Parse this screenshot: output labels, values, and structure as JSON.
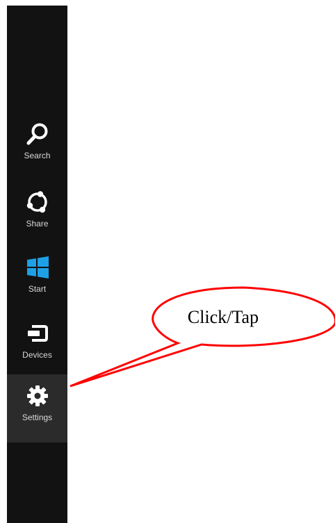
{
  "charms": [
    {
      "id": "search",
      "label": "Search",
      "icon": "search-icon"
    },
    {
      "id": "share",
      "label": "Share",
      "icon": "share-icon"
    },
    {
      "id": "start",
      "label": "Start",
      "icon": "windows-logo-icon"
    },
    {
      "id": "devices",
      "label": "Devices",
      "icon": "devices-icon"
    },
    {
      "id": "settings",
      "label": "Settings",
      "icon": "gear-icon",
      "selected": true
    }
  ],
  "callout": {
    "text": "Click/Tap",
    "border_color": "#ff0000"
  },
  "colors": {
    "bar_background": "#121212",
    "selected_background": "#2b2b2b",
    "start_logo": "#1ea0e6",
    "label": "#d8d8d8"
  }
}
